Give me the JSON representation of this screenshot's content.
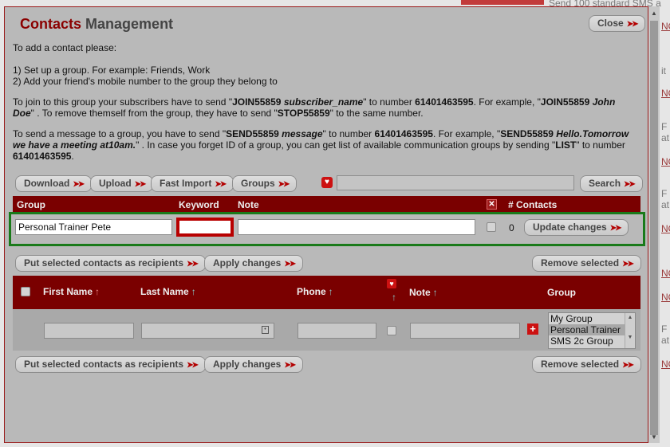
{
  "background": {
    "right_texts": [
      "Send 100 standard SMS a",
      "NO",
      "it",
      "NO",
      "F",
      "at",
      "NO",
      "F",
      "at",
      "NO",
      "NO",
      "NO",
      "F",
      "at",
      "NO"
    ]
  },
  "dialog": {
    "title_accent": "Contacts",
    "title_rest": "Management",
    "close_label": "Close"
  },
  "instructions": {
    "intro": "To add a contact please:",
    "step1": "1) Set up a group. For example: Friends, Work",
    "step2": "2) Add your friend's mobile number to the group they belong to",
    "join_line1_a": "To join to this group your subscribers have to send \"",
    "join_code": "JOIN55859",
    "join_var": "subscriber_name",
    "join_line1_b": "\" to number ",
    "join_number": "61401463595",
    "join_line1_c": ". For example, \"",
    "join_example": "JOIN55859",
    "join_example_var": "John",
    "join_line2_var": "Doe",
    "join_line2_a": "\" . To remove themself from the group, they have to send \"",
    "stop_code": "STOP55859",
    "join_line2_b": "\" to the same number.",
    "send_line1_a": "To send a message to a group, you have to send \"",
    "send_code": "SEND55859",
    "send_var": "message",
    "send_line1_b": "\" to number ",
    "send_number": "61401463595",
    "send_line1_c": ". For example, \"",
    "send_example": "SEND55859",
    "send_example_var": "Hello.Tomorrow",
    "send_line2_var": "we have a meeting at10am.",
    "send_line2_a": "\" . In case you forget ID of a group, you can get list of available communication groups by sending \"",
    "list_code": "LIST",
    "send_line2_b": "\" to number",
    "send_line3_number": "61401463595",
    "send_line3_end": "."
  },
  "toolbar": {
    "download": "Download",
    "upload": "Upload",
    "fast_import": "Fast Import",
    "groups": "Groups",
    "search_value": "",
    "search": "Search"
  },
  "group_table": {
    "headers": [
      "Group",
      "Keyword",
      "Note",
      "# Contacts"
    ],
    "row": {
      "group": "Personal Trainer Pete",
      "keyword": "",
      "note": "",
      "contacts": "0",
      "update": "Update changes"
    }
  },
  "actions": {
    "put_selected": "Put selected contacts as recipients",
    "apply_changes": "Apply changes",
    "remove_selected": "Remove selected"
  },
  "contacts_table": {
    "headers": {
      "first_name": "First Name",
      "last_name": "Last Name",
      "phone": "Phone",
      "note": "Note",
      "group": "Group"
    },
    "sort_arrow": "↑",
    "group_options": [
      "My Group",
      "Personal Trainer",
      "SMS 2c Group"
    ],
    "selected_group": "Personal Trainer"
  }
}
